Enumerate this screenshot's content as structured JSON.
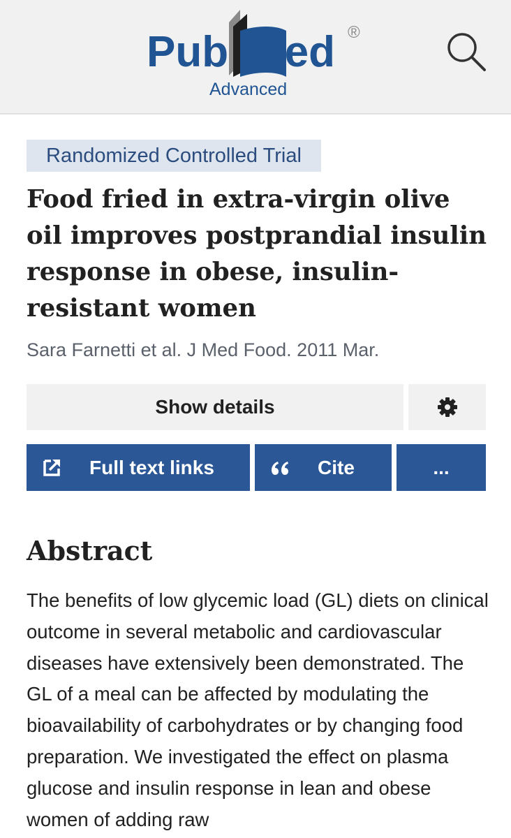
{
  "header": {
    "logo_primary": "Pub",
    "logo_secondary": "Med",
    "logo_registered": "®",
    "logo_sub": "Advanced",
    "search_icon": "search-icon"
  },
  "article": {
    "publication_type": "Randomized Controlled Trial",
    "title": "Food fried in extra-virgin olive oil improves postprandial insulin response in obese, insulin-resistant women",
    "authors": "Sara Farnetti et al. J Med Food. 2011 Mar."
  },
  "actions": {
    "show_details": "Show details",
    "settings_icon": "gear-icon",
    "full_text": "Full text links",
    "full_text_icon": "external-link-icon",
    "cite": "Cite",
    "cite_icon": "quote-icon",
    "more": "..."
  },
  "abstract": {
    "heading": "Abstract",
    "text": "The benefits of low glycemic load (GL) diets on clinical outcome in several metabolic and cardiovascular diseases have extensively been demonstrated. The GL of a meal can be affected by modulating the bioavailability of carbohydrates or by changing food preparation. We investigated the effect on plasma glucose and insulin response in lean and obese women of adding raw"
  },
  "colors": {
    "brand_blue": "#2b5797",
    "logo_blue": "#205493",
    "tag_background": "#dfe5ef",
    "header_background": "#f1f1f1"
  }
}
